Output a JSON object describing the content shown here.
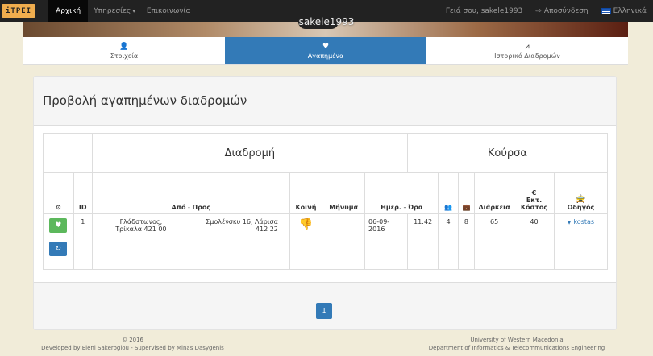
{
  "nav": {
    "brand": "iTΡΕΙ",
    "home": "Αρχική",
    "services": "Υπηρεσίες",
    "contact": "Επικοινωνία",
    "greeting": "Γειά σου, sakele1993",
    "logout": "Αποσύνδεση",
    "language": "Ελληνικά"
  },
  "profile": {
    "username": "sakele1993"
  },
  "tabs": [
    {
      "icon": "user-icon",
      "label": "Στοιχεία"
    },
    {
      "icon": "heart-icon",
      "label": "Αγαπημένα"
    },
    {
      "icon": "road-icon",
      "label": "Ιστορικό Διαδρομών"
    }
  ],
  "panel": {
    "title": "Προβολή αγαπημένων διαδρομών"
  },
  "table": {
    "group_route": "Διαδρομή",
    "group_ride": "Κούρσα",
    "headers": {
      "id": "ID",
      "from": "Από",
      "dash1": " - ",
      "to": "Προς",
      "shared": "Κοινή",
      "message": "Μήνυμα",
      "date": "Ημερ.",
      "dash2": " - ",
      "time": "Ώρα",
      "duration": "Διάρκεια",
      "euro": "€",
      "est_cost": "Εκτ. Κόστος",
      "driver": "Οδηγός"
    },
    "rows": [
      {
        "id": "1",
        "from": "Γλάδστωνος, Τρίκαλα 421 00",
        "to": "Σμολένσκυ 16, Λάρισα 412 22",
        "message": "",
        "date": "06-09-2016",
        "time": "11:42",
        "passengers": "4",
        "luggage": "8",
        "duration": "65",
        "cost": "40",
        "driver": "kostas"
      }
    ]
  },
  "pagination": {
    "current": "1"
  },
  "footer": {
    "year": "© 2016",
    "developer": "Developed by Eleni Sakeroglou - Supervised by Minas Dasygenis",
    "university": "University of Western Macedonia",
    "department": "Department of Informatics & Telecommunications Engineering"
  },
  "colors": {
    "primary": "#337ab7",
    "success": "#5cb85c",
    "navbar": "#222222",
    "brand": "#f0ad4e"
  }
}
